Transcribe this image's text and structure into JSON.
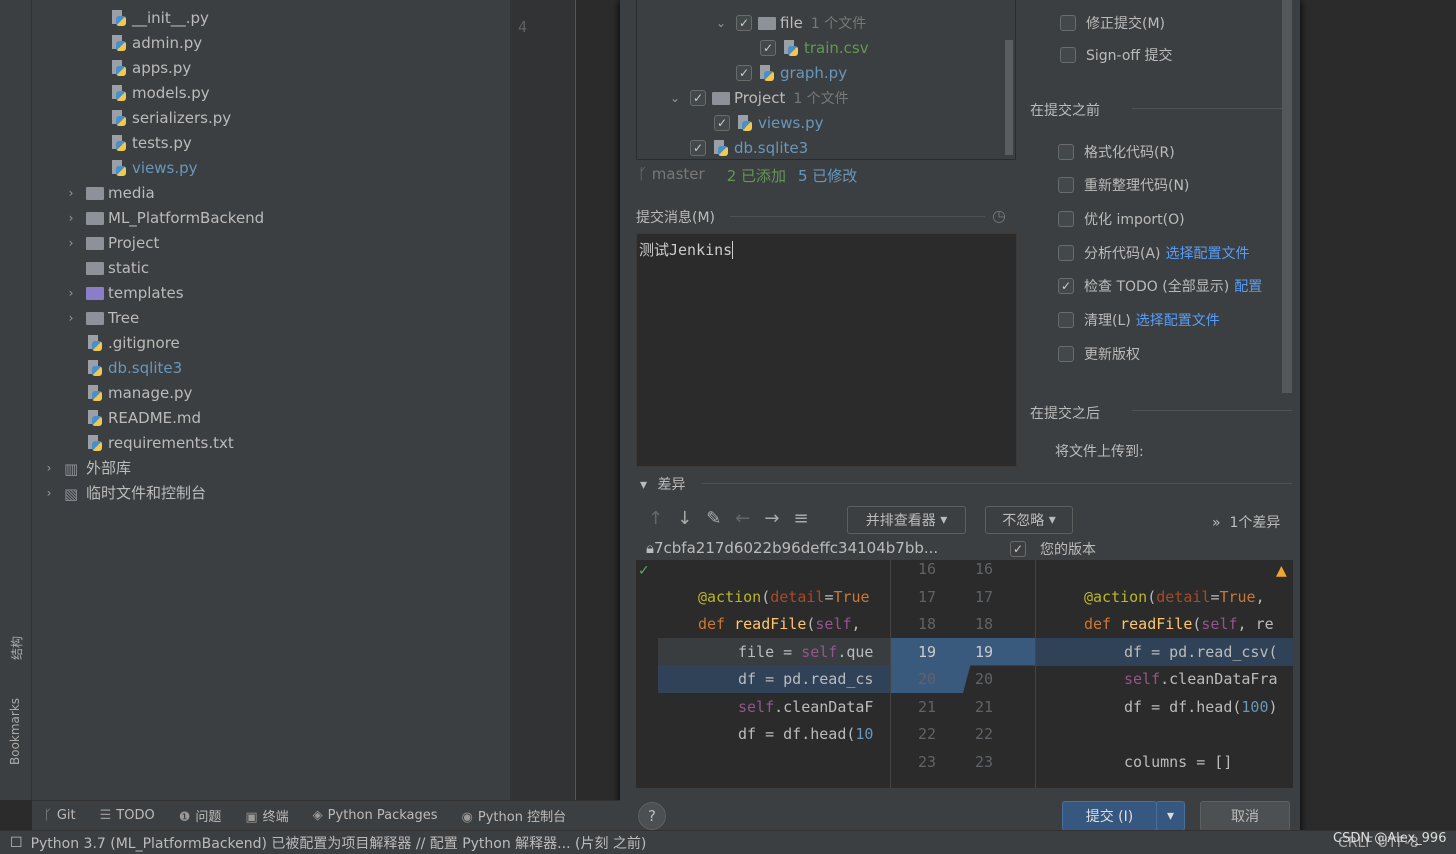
{
  "side_tools": {
    "structure": "结构",
    "bookmarks": "Bookmarks"
  },
  "tree": {
    "items": [
      {
        "label": "__init__.py",
        "type": "py"
      },
      {
        "label": "admin.py",
        "type": "py"
      },
      {
        "label": "apps.py",
        "type": "py"
      },
      {
        "label": "models.py",
        "type": "py"
      },
      {
        "label": "serializers.py",
        "type": "py"
      },
      {
        "label": "tests.py",
        "type": "py"
      },
      {
        "label": "views.py",
        "type": "py",
        "modified": true
      },
      {
        "label": "media",
        "type": "folder"
      },
      {
        "label": "ML_PlatformBackend",
        "type": "folder"
      },
      {
        "label": "Project",
        "type": "folder"
      },
      {
        "label": "static",
        "type": "folder"
      },
      {
        "label": "templates",
        "type": "folder"
      },
      {
        "label": "Tree",
        "type": "folder"
      },
      {
        "label": ".gitignore",
        "type": "file"
      },
      {
        "label": "db.sqlite3",
        "type": "file",
        "modified": true
      },
      {
        "label": "manage.py",
        "type": "py"
      },
      {
        "label": "README.md",
        "type": "file"
      },
      {
        "label": "requirements.txt",
        "type": "file"
      },
      {
        "label": "外部库",
        "type": "lib"
      },
      {
        "label": "临时文件和控制台",
        "type": "scratch"
      }
    ]
  },
  "editor": {
    "line": "4"
  },
  "commit": {
    "files": [
      {
        "label": "file",
        "count": "1 个文件"
      },
      {
        "label": "train.csv",
        "color": "green"
      },
      {
        "label": "graph.py",
        "color": "blue"
      },
      {
        "label": "Project",
        "count": "1 个文件"
      },
      {
        "label": "views.py",
        "color": "blue"
      },
      {
        "label": "db.sqlite3",
        "color": "blue"
      }
    ],
    "branch": "master",
    "added": "2 已添加",
    "modified": "5 已修改",
    "message_label": "提交消息(M)",
    "message": "测试Jenkins",
    "options_top": [
      {
        "label": "修正提交(M)",
        "checked": false
      },
      {
        "label": "Sign-off 提交",
        "checked": false
      }
    ],
    "before_title": "在提交之前",
    "before": [
      {
        "label": "格式化代码(R)",
        "checked": false
      },
      {
        "label": "重新整理代码(N)",
        "checked": false
      },
      {
        "label": "优化 import(O)",
        "checked": false
      },
      {
        "label": "分析代码(A)",
        "link": "选择配置文件",
        "checked": false
      },
      {
        "label": "检查 TODO (全部显示)",
        "link": "配置",
        "checked": true
      },
      {
        "label": "清理(L)",
        "link": "选择配置文件",
        "checked": false
      },
      {
        "label": "更新版权",
        "checked": false
      }
    ],
    "after_title": "在提交之后",
    "upload_label": "将文件上传到:",
    "diff_title": "差异",
    "viewer": "并排查看器",
    "ignore": "不忽略",
    "diff_count": "1个差异",
    "left_hash": "7cbfa217d6022b96deffc34104b7bb...",
    "right_label": "您的版本",
    "line_numbers": [
      "16",
      "17",
      "18",
      "19",
      "20",
      "21",
      "22",
      "23"
    ],
    "commit_button": "提交 (I)",
    "cancel_button": "取消",
    "help": "?"
  },
  "toolbar": [
    "Git",
    "TODO",
    "问题",
    "终端",
    "Python Packages",
    "Python 控制台"
  ],
  "status": {
    "text": "Python 3.7 (ML_PlatformBackend) 已被配置为项目解释器 // 配置 Python 解释器... (片刻 之前)",
    "right": "CRLF  UTF-8",
    "watermark": "CSDN @Alex_996"
  }
}
